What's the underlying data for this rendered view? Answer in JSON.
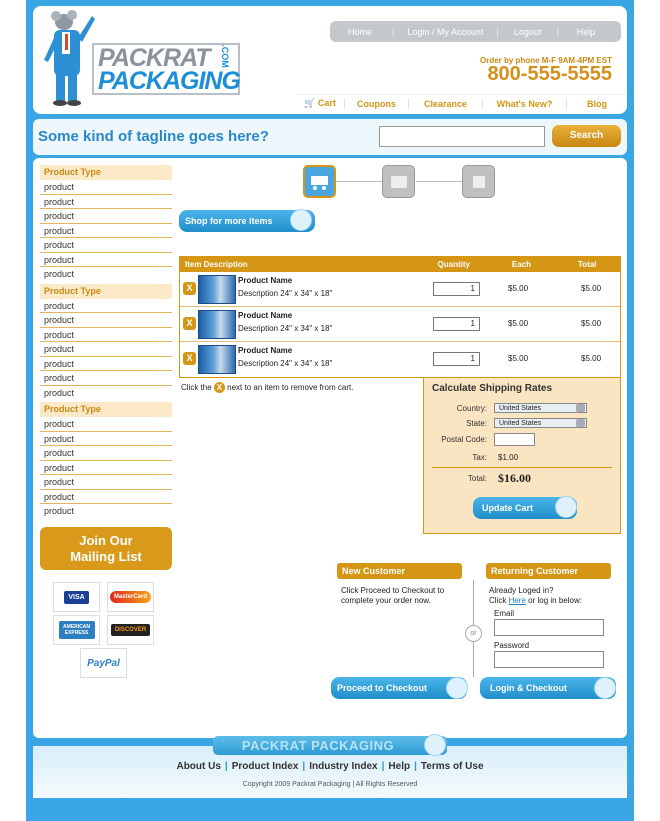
{
  "brand": {
    "line1": "PACKRAT",
    "line2": "PACKAGING",
    "suffix": ".COM"
  },
  "top_nav": [
    "Home",
    "Login / My Account",
    "Logout",
    "Help"
  ],
  "phone": {
    "hours": "Order by phone M-F 9AM-4PM EST",
    "number": "800-555-5555"
  },
  "sub_nav": [
    "Cart",
    "Coupons",
    "Clearance",
    "What's New?",
    "Blog"
  ],
  "tagline": "Some kind of tagline goes here?",
  "search": {
    "button": "Search",
    "value": ""
  },
  "sidebar": {
    "groups": [
      {
        "title": "Product Type",
        "items": [
          "product",
          "product",
          "product",
          "product",
          "product",
          "product",
          "product"
        ]
      },
      {
        "title": "Product Type",
        "items": [
          "product",
          "product",
          "product",
          "product",
          "product",
          "product",
          "product"
        ]
      },
      {
        "title": "Product Type",
        "items": [
          "product",
          "product",
          "product",
          "product",
          "product",
          "product",
          "product"
        ]
      }
    ],
    "mailing_line1": "Join Our",
    "mailing_line2": "Mailing List",
    "cards": [
      "VISA",
      "MasterCard",
      "AMERICAN EXPRESS",
      "DISCOVER",
      "PayPal"
    ]
  },
  "shop_more": "Shop for more items",
  "cart": {
    "headers": [
      "Item Description",
      "Quantity",
      "Each",
      "Total"
    ],
    "rows": [
      {
        "name": "Product Name",
        "desc": "Description 24\" x 34\" x 18\"",
        "qty": "1",
        "each": "$5.00",
        "total": "$5.00"
      },
      {
        "name": "Product Name",
        "desc": "Description 24\" x 34\" x 18\"",
        "qty": "1",
        "each": "$5.00",
        "total": "$5.00"
      },
      {
        "name": "Product Name",
        "desc": "Description 24\" x 34\" x 18\"",
        "qty": "1",
        "each": "$5.00",
        "total": "$5.00"
      }
    ],
    "remove_note_a": "Click the",
    "remove_note_b": "next to an item to remove from cart.",
    "remove_x": "X"
  },
  "shipping": {
    "title": "Calculate Shipping Rates",
    "country_label": "Country:",
    "country": "United States",
    "state_label": "State:",
    "state": "United States",
    "postal_label": "Postal Code:",
    "tax_label": "Tax:",
    "tax": "$1.00",
    "total_label": "Total:",
    "total": "$16.00",
    "update": "Update Cart"
  },
  "new_customer": {
    "title": "New Customer",
    "text1": "Click Proceed to Checkout to",
    "text2": "complete your order now.",
    "button": "Proceed to Checkout"
  },
  "or": "or",
  "returning": {
    "title": "Returning Customer",
    "text1": "Already Loged in?",
    "link": "Here",
    "text2a": "Click",
    "text2b": "or log in below:",
    "email": "Email",
    "password": "Password",
    "button": "Login & Checkout"
  },
  "footer": {
    "logo": "PACKRAT PACKAGING",
    "links": [
      "About Us",
      "Product Index",
      "Industry Index",
      "Help",
      "Terms of Use"
    ],
    "copyright": "Copyright 2009 Packrat Packaging | All Rights Reserved"
  },
  "colors": {
    "frame": "#3aa6e4",
    "accent": "#d49614",
    "button_blue": "#1f8ec9"
  }
}
